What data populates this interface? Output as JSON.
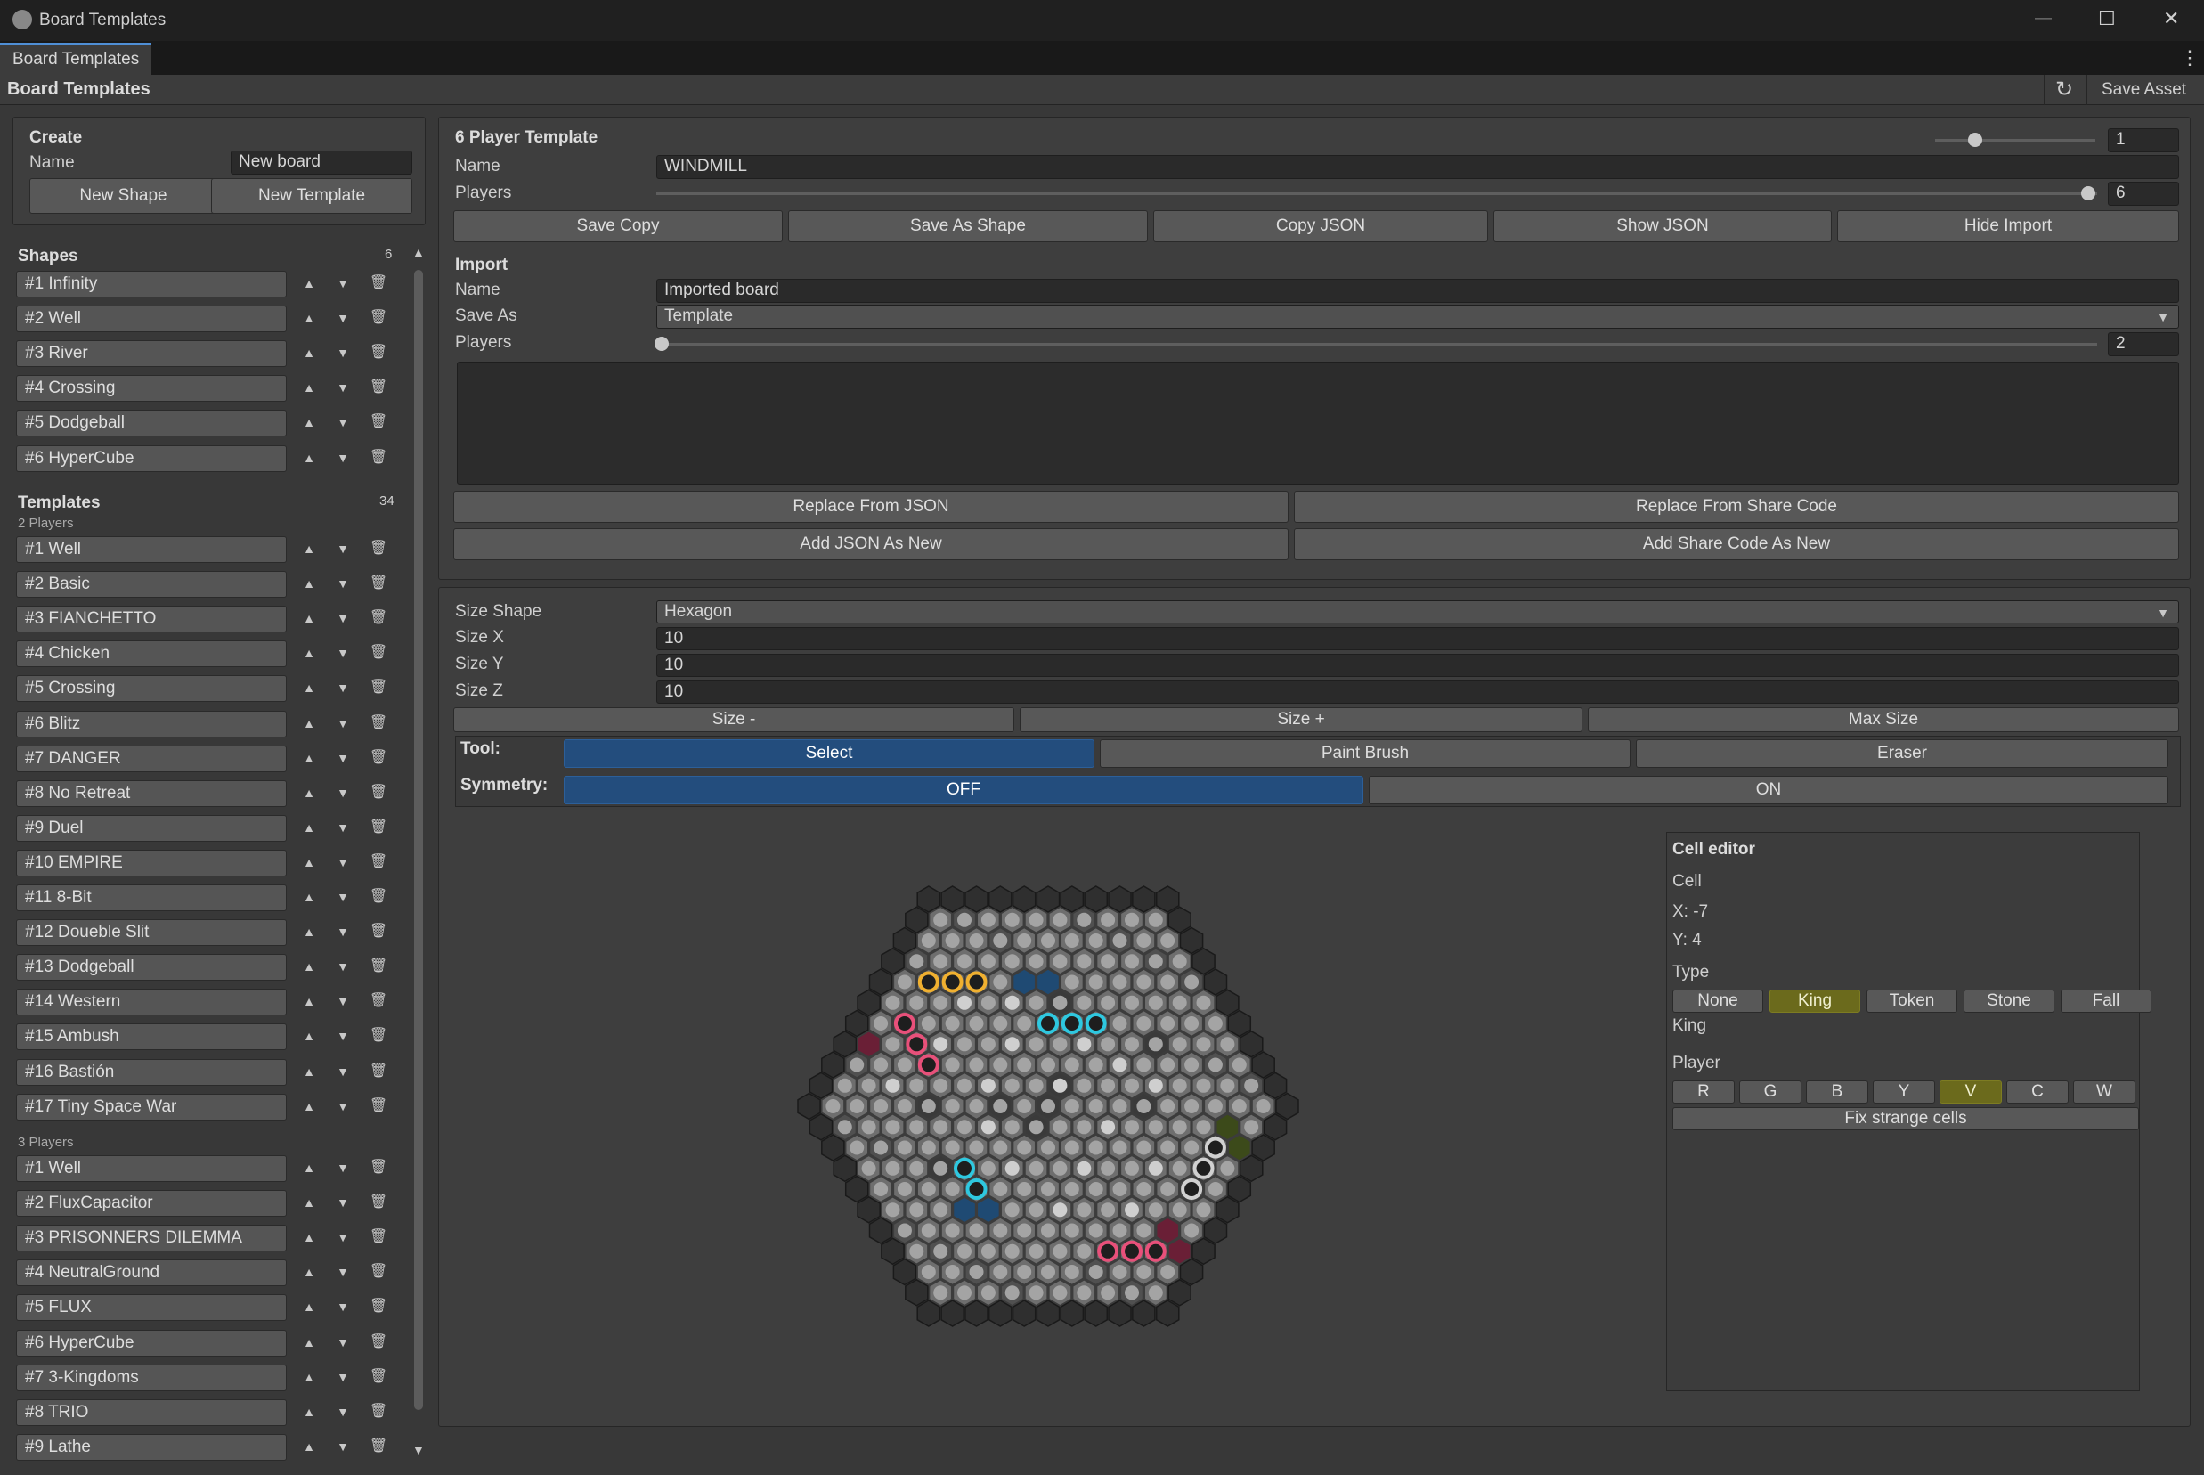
{
  "window": {
    "title": "Board Templates",
    "tab": "Board Templates",
    "header": "Board Templates",
    "refresh_icon": "↻",
    "save_asset": "Save Asset",
    "more_icon": "⋮",
    "minimize": "—",
    "maximize": "☐",
    "close": "✕"
  },
  "create": {
    "title": "Create",
    "name_label": "Name",
    "name_value": "New board",
    "new_shape": "New Shape",
    "new_template": "New Template"
  },
  "shapes": {
    "title": "Shapes",
    "count": "6",
    "items": [
      "#1  Infinity",
      "#2  Well",
      "#3  River",
      "#4  Crossing",
      "#5  Dodgeball",
      "#6  HyperCube"
    ]
  },
  "templates": {
    "title": "Templates",
    "count": "34",
    "group1_label": "2 Players",
    "group1": [
      "#1  Well",
      "#2  Basic",
      "#3  FIANCHETTO",
      "#4  Chicken",
      "#5  Crossing",
      "#6  Blitz",
      "#7  DANGER",
      "#8  No Retreat",
      "#9  Duel",
      "#10  EMPIRE",
      "#11  8-Bit",
      "#12  Doueble Slit",
      "#13  Dodgeball",
      "#14  Western",
      "#15  Ambush",
      "#16  Bastión",
      "#17  Tiny Space War"
    ],
    "group2_label": "3 Players",
    "group2": [
      "#1  Well",
      "#2  FluxCapacitor",
      "#3  PRISONNERS DILEMMA",
      "#4  NeutralGround",
      "#5  FLUX",
      "#6  HyperCube",
      "#7  3-Kingdoms",
      "#8  TRIO",
      "#9  Lathe"
    ]
  },
  "list_controls": {
    "up": "▲",
    "down": "▼",
    "delete": "🗑"
  },
  "editor": {
    "title": "6 Player Template",
    "index_value": "1",
    "index_fraction": 0.25,
    "name_label": "Name",
    "name_value": "WINDMILL",
    "players_label": "Players",
    "players_value": "6",
    "players_fraction": 1.0,
    "save_copy": "Save Copy",
    "save_as_shape": "Save As Shape",
    "copy_json": "Copy JSON",
    "show_json": "Show JSON",
    "hide_import": "Hide Import"
  },
  "import": {
    "title": "Import",
    "name_label": "Name",
    "name_value": "Imported board",
    "save_as_label": "Save As",
    "save_as_value": "Template",
    "players_label": "Players",
    "players_value": "2",
    "players_fraction": 0.0,
    "replace_json": "Replace From JSON",
    "replace_share": "Replace From Share Code",
    "add_json": "Add JSON As New",
    "add_share": "Add Share Code As New"
  },
  "size": {
    "shape_label": "Size Shape",
    "shape_value": "Hexagon",
    "x_label": "Size X",
    "x_value": "10",
    "y_label": "Size Y",
    "y_value": "10",
    "z_label": "Size Z",
    "z_value": "10",
    "minus": "Size -",
    "plus": "Size +",
    "max": "Max Size"
  },
  "tool": {
    "label": "Tool:",
    "select": "Select",
    "paint": "Paint Brush",
    "eraser": "Eraser",
    "active": "Select"
  },
  "symmetry": {
    "label": "Symmetry:",
    "off": "OFF",
    "on": "ON",
    "active": "OFF"
  },
  "cell_editor": {
    "title": "Cell editor",
    "cell_label": "Cell",
    "x": "X: -7",
    "y": "Y: 4",
    "type_label": "Type",
    "types": [
      "None",
      "King",
      "Token",
      "Stone",
      "Fall"
    ],
    "active_type": "King",
    "type_value": "King",
    "player_label": "Player",
    "players": [
      "R",
      "G",
      "B",
      "Y",
      "V",
      "C",
      "W"
    ],
    "active_player": "V",
    "fix": "Fix strange cells"
  },
  "colors": {
    "selected": "#234d7d",
    "highlight": "#6b6a1c",
    "accent": "#4f8fd6"
  }
}
